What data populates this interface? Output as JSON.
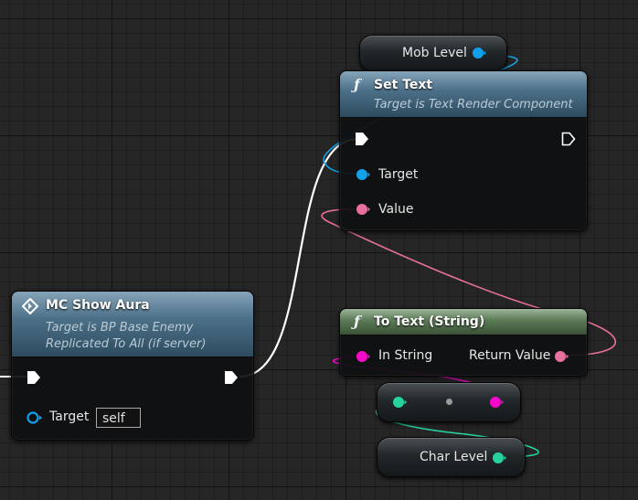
{
  "colors": {
    "exec": "#ffffff",
    "object": "#11a1e8",
    "text": "#e9709e",
    "string": "#f50aca",
    "integer": "#26d3a0",
    "blue_header": "#4c7088",
    "green_header": "#5b7a56"
  },
  "nodes": {
    "mob_level": {
      "label": "Mob Level",
      "icon": "object-pin-icon"
    },
    "set_text": {
      "icon": "function-icon",
      "title": "Set Text",
      "subtitle": "Target is Text Render Component",
      "pins": {
        "target": "Target",
        "value": "Value"
      }
    },
    "mc_show_aura": {
      "icon": "event-icon",
      "title": "MC Show Aura",
      "subtitle_1": "Target is BP Base Enemy",
      "subtitle_2": "Replicated To All (if server)",
      "pins": {
        "target": "Target",
        "target_default": "self"
      }
    },
    "to_text_string": {
      "icon": "function-icon",
      "title": "To Text (String)",
      "pins": {
        "in_string": "In String",
        "return_value": "Return Value"
      }
    },
    "conversion": {
      "icon": "conversion-dot-icon"
    },
    "char_level": {
      "label": "Char Level",
      "icon": "integer-pin-icon"
    }
  }
}
